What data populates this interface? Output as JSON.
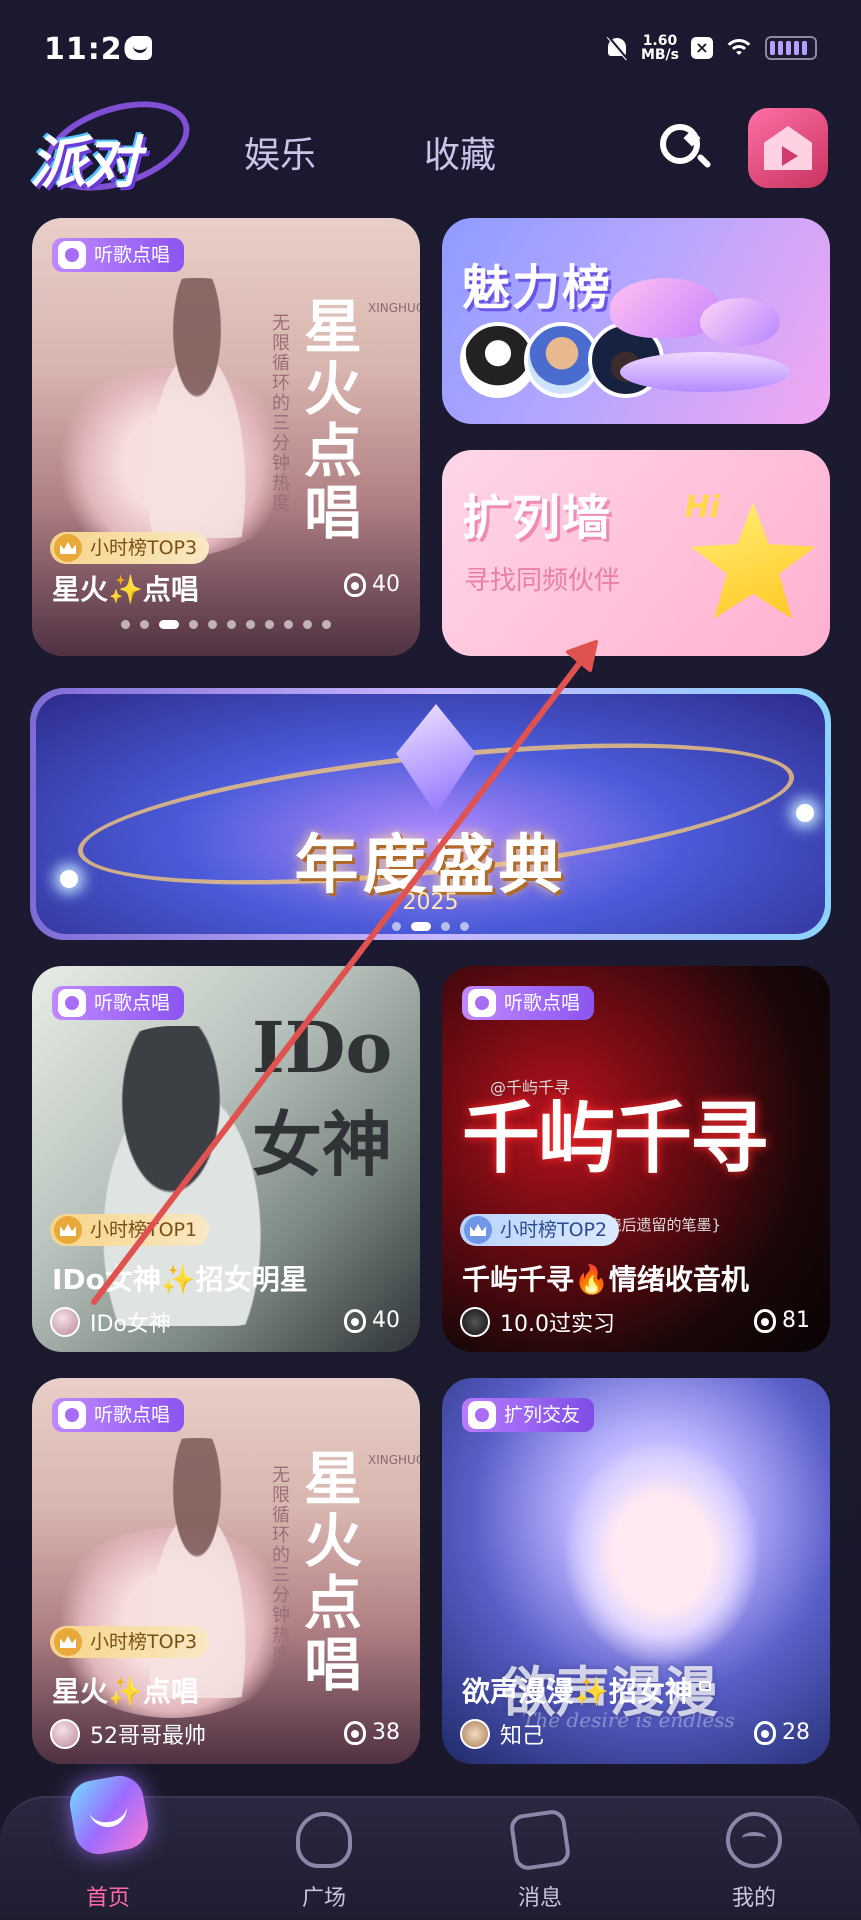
{
  "status_bar": {
    "time": "11:26",
    "net_speed_value": "1.60",
    "net_speed_unit": "MB/s",
    "icons": [
      "message-icon",
      "bell-off-icon",
      "x-badge-icon",
      "wifi-icon",
      "battery-icon"
    ]
  },
  "header": {
    "logo": "派对",
    "tabs": [
      {
        "label": "娱乐"
      },
      {
        "label": "收藏"
      }
    ],
    "icons": [
      "search-icon",
      "create-room-icon"
    ]
  },
  "cards": {
    "star_top": {
      "tag": "听歌点唱",
      "art_title": "星火点唱",
      "art_sub": "无限循环的三分钟热度",
      "art_pinyin": "XINGHUO",
      "rank": "小时榜TOP3",
      "title": "星火✨点唱",
      "heat": "40"
    },
    "charm": {
      "title": "魅力榜"
    },
    "wall": {
      "title": "扩列墙",
      "hi": "Hi",
      "subtitle": "寻找同频伙伴"
    },
    "banner": {
      "title": "年度盛典",
      "year": "2025"
    },
    "ido": {
      "tag": "听歌点唱",
      "art": "IDo女神",
      "rank": "小时榜TOP1",
      "title": "IDo女神✨招女明星",
      "host": "IDo女神",
      "heat": "40"
    },
    "qianxun": {
      "tag": "听歌点唱",
      "art_handle": "@千屿千寻",
      "art": "千屿千寻",
      "art_sub": "{我是春天焚烧后遗留的笔墨}",
      "rank": "小时榜TOP2",
      "title": "千屿千寻🔥情绪收音机",
      "host": "10.0过实习",
      "heat": "81"
    },
    "star_bottom": {
      "tag": "听歌点唱",
      "art_title": "星火点唱",
      "art_sub": "无限循环的三分钟热度",
      "art_pinyin": "XINGHUO",
      "rank": "小时榜TOP3",
      "title": "星火✨点唱",
      "host": "52哥哥最帅",
      "heat": "38"
    },
    "yusheng": {
      "tag": "扩列交友",
      "art": "欲声漫漫",
      "art_sub": "The desire is endless",
      "title": "欲声漫漫✨招女神",
      "host": "知己",
      "heat": "28"
    }
  },
  "bottom_nav": [
    {
      "label": "首页",
      "active": true
    },
    {
      "label": "广场",
      "active": false
    },
    {
      "label": "消息",
      "active": false
    },
    {
      "label": "我的",
      "active": false
    }
  ],
  "colors": {
    "background": "#1b1930",
    "accent_pink": "#ff6aa8",
    "tag_purple": "#8b55f0",
    "gesture_arrow": "#e0524f"
  }
}
